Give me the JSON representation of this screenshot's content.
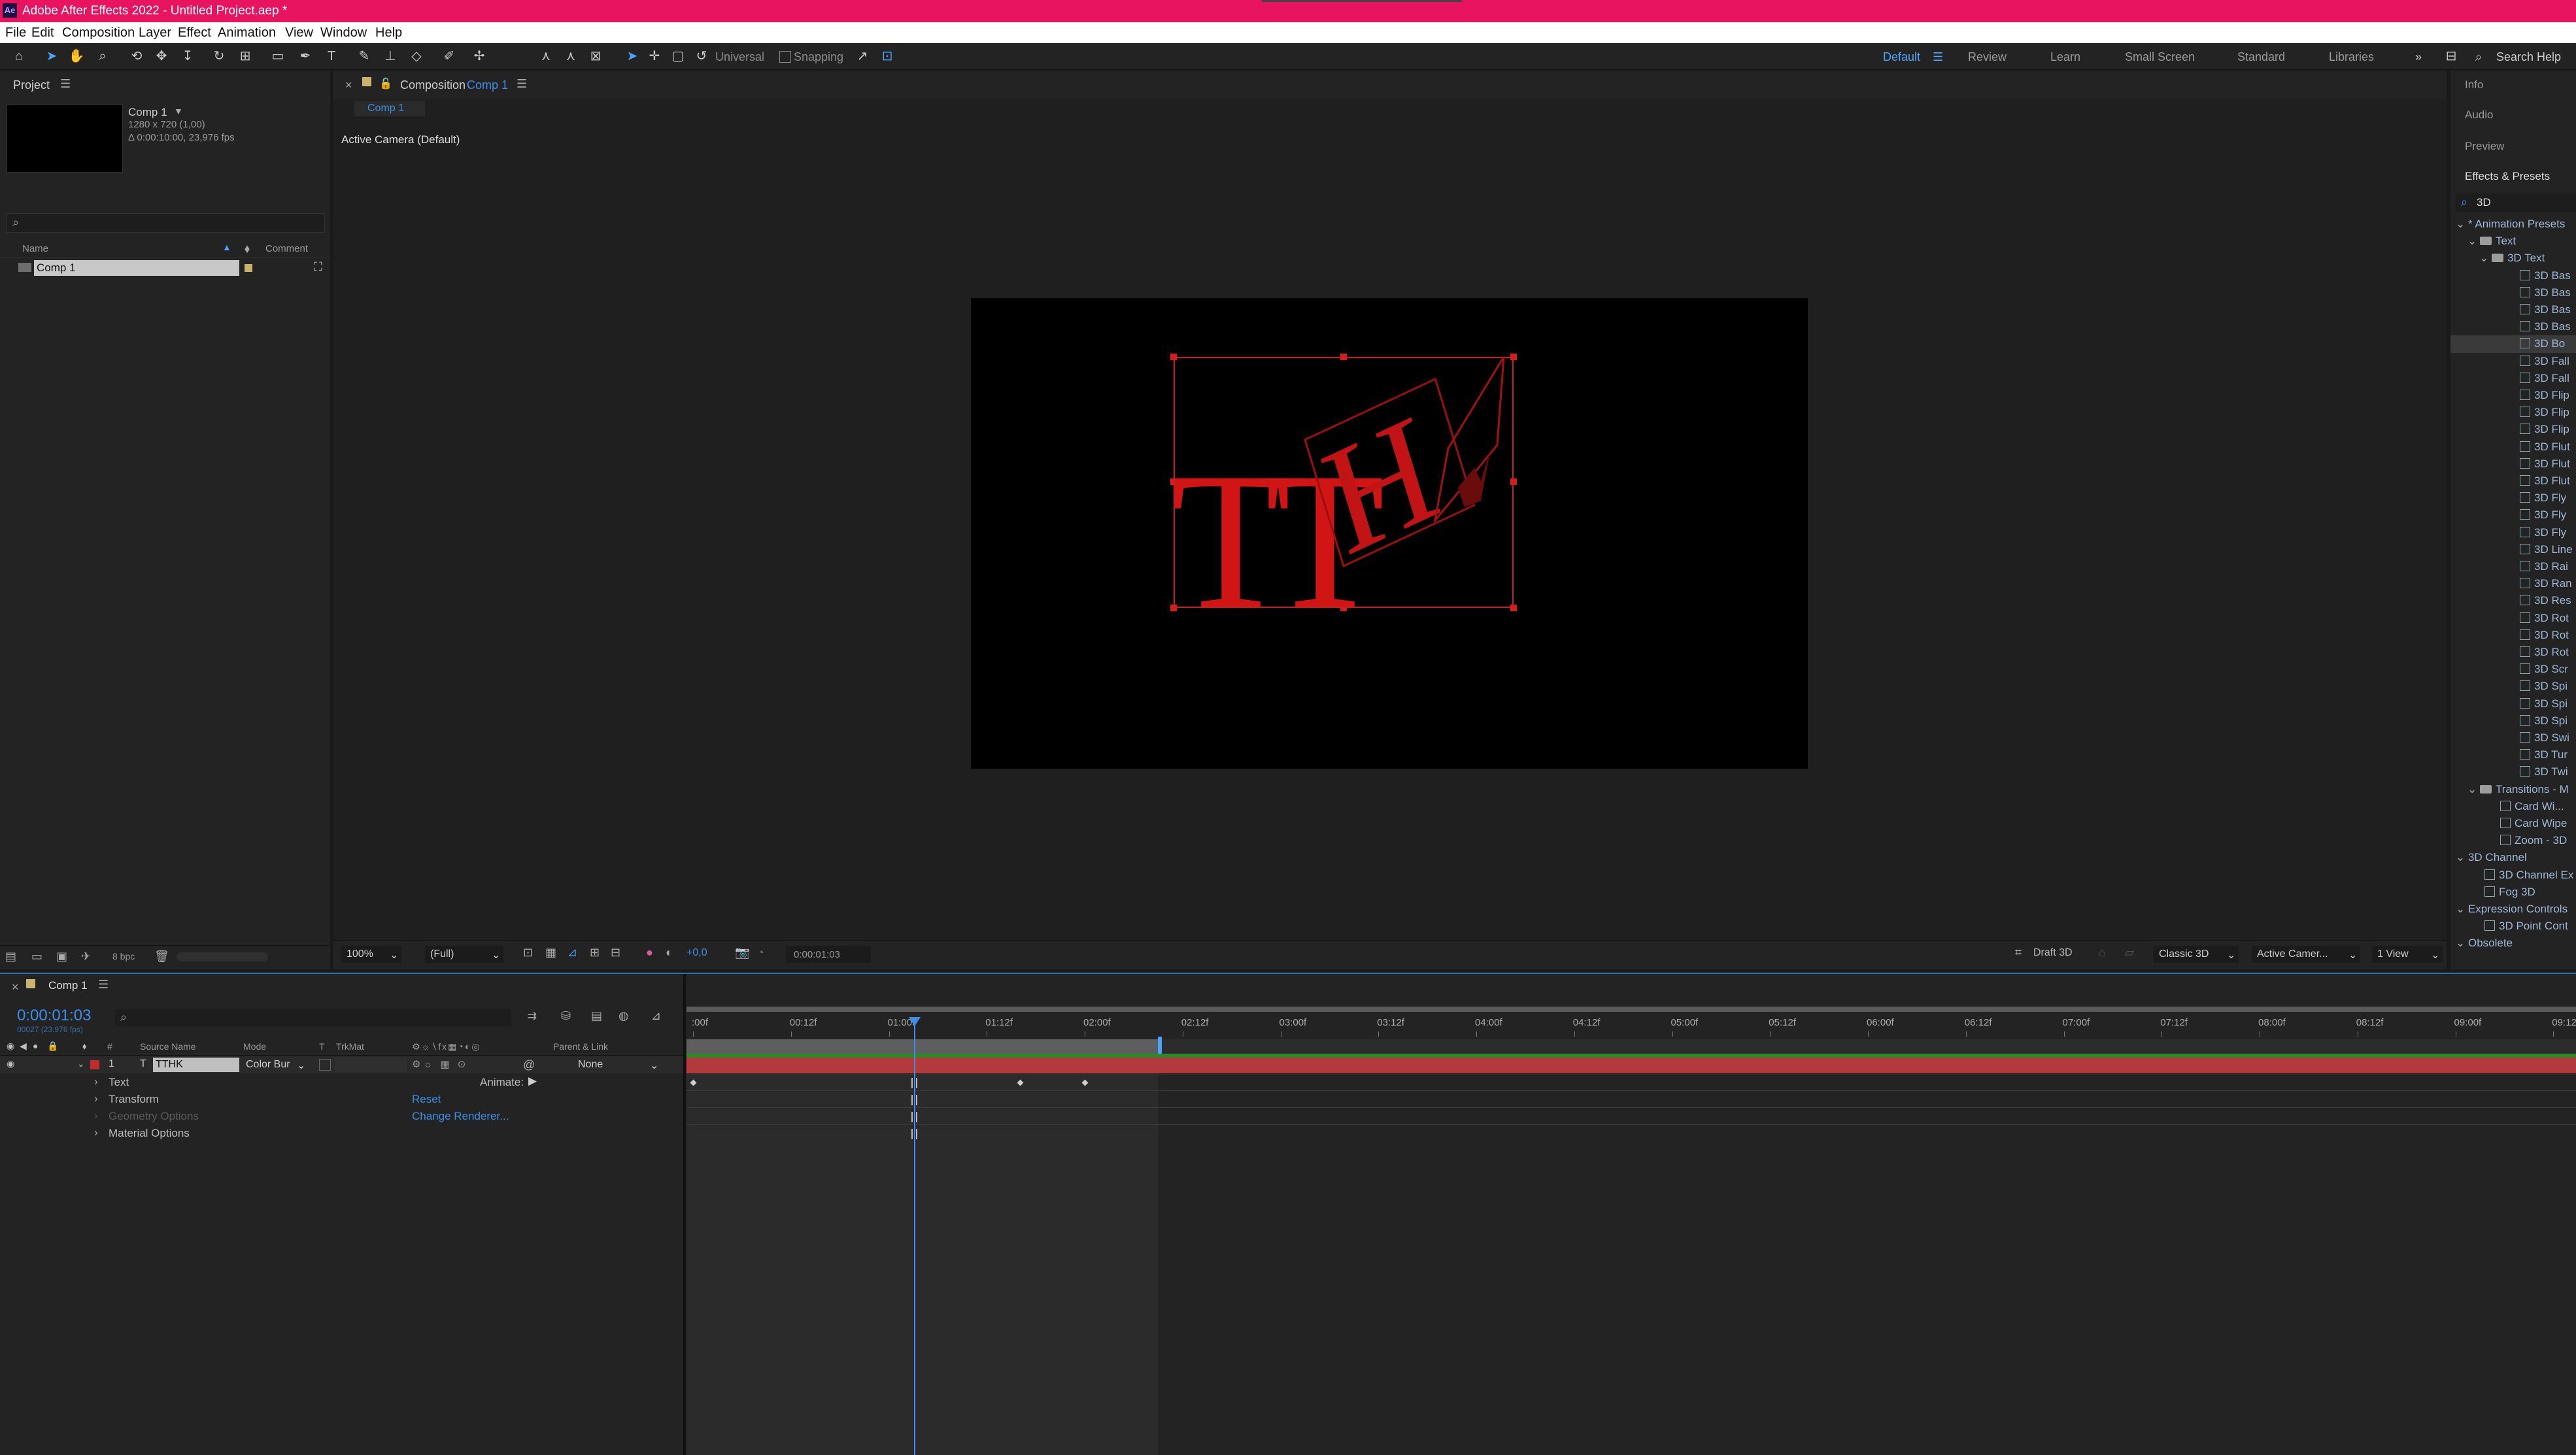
{
  "app": {
    "logo_text": "Ae",
    "title": "Adobe After Effects 2022 - Untitled Project.aep *"
  },
  "menu": [
    "File",
    "Edit",
    "Composition",
    "Layer",
    "Effect",
    "Animation",
    "View",
    "Window",
    "Help"
  ],
  "toolbar": {
    "universal_label": "Universal",
    "snapping_label": "Snapping",
    "workspaces": [
      "Default",
      "Review",
      "Learn",
      "Small Screen",
      "Standard",
      "Libraries"
    ],
    "active_workspace": "Default",
    "search_help": "Search Help"
  },
  "project": {
    "title": "Project",
    "comp_name": "Comp 1",
    "comp_dims": "1280 x 720 (1,00)",
    "comp_duration": "Δ 0:00:10:00, 23,976 fps",
    "col_name": "Name",
    "col_comment": "Comment",
    "items": [
      {
        "name": "Comp 1"
      }
    ],
    "bpc": "8 bpc"
  },
  "composition": {
    "tab_prefix": "Composition",
    "tab_name": "Comp 1",
    "breadcrumb": "Comp 1",
    "camera_label": "Active Camera (Default)",
    "text_content": "TTHK",
    "zoom": "100%",
    "resolution": "(Full)",
    "exposure": "+0,0",
    "timecode": "0:00:01:03",
    "draft3d": "Draft 3D",
    "renderer": "Classic 3D",
    "view": "Active Camer...",
    "view_layout": "1 View"
  },
  "right_panel": {
    "tabs": [
      "Info",
      "Audio",
      "Preview",
      "Effects & Presets"
    ],
    "search_value": "3D",
    "tree": [
      {
        "label": "* Animation Presets",
        "level": 0,
        "type": "group"
      },
      {
        "label": "Text",
        "level": 1,
        "type": "folder"
      },
      {
        "label": "3D Text",
        "level": 2,
        "type": "folder"
      },
      {
        "label": "3D Bas",
        "level": 3,
        "type": "preset"
      },
      {
        "label": "3D Bas",
        "level": 3,
        "type": "preset"
      },
      {
        "label": "3D Bas",
        "level": 3,
        "type": "preset"
      },
      {
        "label": "3D Bas",
        "level": 3,
        "type": "preset"
      },
      {
        "label": "3D Bo",
        "level": 3,
        "type": "preset",
        "selected": true
      },
      {
        "label": "3D Fall",
        "level": 3,
        "type": "preset"
      },
      {
        "label": "3D Fall",
        "level": 3,
        "type": "preset"
      },
      {
        "label": "3D Flip",
        "level": 3,
        "type": "preset"
      },
      {
        "label": "3D Flip",
        "level": 3,
        "type": "preset"
      },
      {
        "label": "3D Flip",
        "level": 3,
        "type": "preset"
      },
      {
        "label": "3D Flut",
        "level": 3,
        "type": "preset"
      },
      {
        "label": "3D Flut",
        "level": 3,
        "type": "preset"
      },
      {
        "label": "3D Flut",
        "level": 3,
        "type": "preset"
      },
      {
        "label": "3D Fly",
        "level": 3,
        "type": "preset"
      },
      {
        "label": "3D Fly",
        "level": 3,
        "type": "preset"
      },
      {
        "label": "3D Fly",
        "level": 3,
        "type": "preset"
      },
      {
        "label": "3D Line",
        "level": 3,
        "type": "preset"
      },
      {
        "label": "3D Rai",
        "level": 3,
        "type": "preset"
      },
      {
        "label": "3D Ran",
        "level": 3,
        "type": "preset"
      },
      {
        "label": "3D Res",
        "level": 3,
        "type": "preset"
      },
      {
        "label": "3D Rot",
        "level": 3,
        "type": "preset"
      },
      {
        "label": "3D Rot",
        "level": 3,
        "type": "preset"
      },
      {
        "label": "3D Rot",
        "level": 3,
        "type": "preset"
      },
      {
        "label": "3D Scr",
        "level": 3,
        "type": "preset"
      },
      {
        "label": "3D Spi",
        "level": 3,
        "type": "preset"
      },
      {
        "label": "3D Spi",
        "level": 3,
        "type": "preset"
      },
      {
        "label": "3D Spi",
        "level": 3,
        "type": "preset"
      },
      {
        "label": "3D Swi",
        "level": 3,
        "type": "preset"
      },
      {
        "label": "3D Tur",
        "level": 3,
        "type": "preset"
      },
      {
        "label": "3D Twi",
        "level": 3,
        "type": "preset"
      },
      {
        "label": "Transitions - M",
        "level": 1,
        "type": "folder"
      },
      {
        "label": "Card Wi...",
        "level": 2,
        "type": "preset"
      },
      {
        "label": "Card Wipe",
        "level": 2,
        "type": "preset"
      },
      {
        "label": "Zoom - 3D",
        "level": 2,
        "type": "preset"
      },
      {
        "label": "3D Channel",
        "level": 0,
        "type": "group"
      },
      {
        "label": "3D Channel Ex",
        "level": 1,
        "type": "preset"
      },
      {
        "label": "Fog 3D",
        "level": 1,
        "type": "preset"
      },
      {
        "label": "Expression Controls",
        "level": 0,
        "type": "group"
      },
      {
        "label": "3D Point Cont",
        "level": 1,
        "type": "preset"
      },
      {
        "label": "Obsolete",
        "level": 0,
        "type": "group"
      }
    ]
  },
  "timeline": {
    "tab": "Comp 1",
    "timecode": "0:00:01:03",
    "frame_info": "00027 (23.976 fps)",
    "cols": {
      "source": "Source Name",
      "mode": "Mode",
      "t": "T",
      "trkmat": "TrkMat",
      "parent": "Parent & Link"
    },
    "layer": {
      "num": "1",
      "type": "T",
      "name": "TTHK",
      "mode": "Color Bur",
      "parent": "None"
    },
    "props": [
      {
        "label": "Text",
        "extra_label": "Animate:",
        "dim": false
      },
      {
        "label": "Transform",
        "extra_label": "Reset",
        "dim": false
      },
      {
        "label": "Geometry Options",
        "extra_label": "Change Renderer...",
        "dim": true
      },
      {
        "label": "Material Options",
        "extra_label": "",
        "dim": false
      }
    ],
    "ruler_labels": [
      ":00f",
      "00:12f",
      "01:00f",
      "01:12f",
      "02:00f",
      "02:12f",
      "03:00f",
      "03:12f",
      "04:00f",
      "04:12f",
      "05:00f",
      "05:12f",
      "06:00f",
      "06:12f",
      "07:00f",
      "07:12f",
      "08:00f",
      "08:12f",
      "09:00f",
      "09:12f"
    ],
    "playhead_seconds": 1.13,
    "work_area_end_seconds": 2.375,
    "keyframes_seconds": [
      0,
      1.67,
      2.0
    ]
  }
}
